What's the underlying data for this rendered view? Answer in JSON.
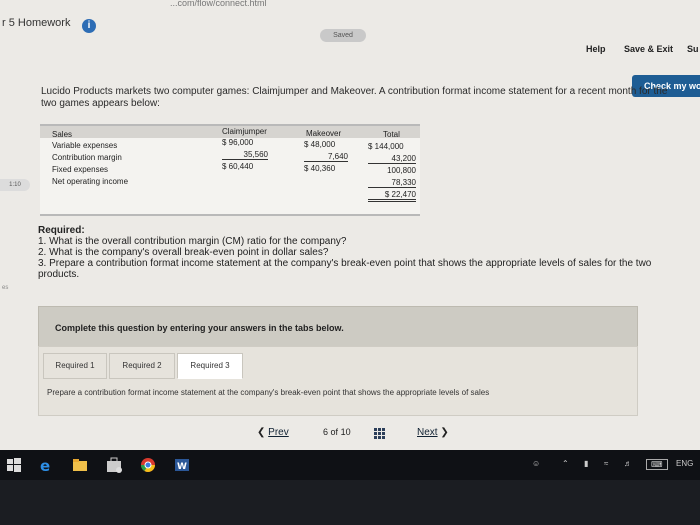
{
  "browser": {
    "url_fragment": "...com/flow/connect.html"
  },
  "header": {
    "assignment_title": "r 5 Homework",
    "info_icon": "info-icon",
    "saved_label": "Saved",
    "help_label": "Help",
    "save_exit_label": "Save & Exit",
    "submit_label": "Su",
    "check_label": "Check my wo"
  },
  "problem": {
    "intro": "Lucido Products markets two computer games: Claimjumper and Makeover. A contribution format income statement for a recent month for the two games appears below:"
  },
  "left_margin": {
    "tag": "1:10",
    "tag2": "es"
  },
  "income_table": {
    "columns": [
      "Claimjumper",
      "Makeover",
      "Total"
    ],
    "rows": [
      {
        "label": "Sales",
        "claimjumper": "$ 96,000",
        "makeover": "$ 48,000",
        "total": "$ 144,000"
      },
      {
        "label": "Variable expenses",
        "claimjumper": "35,560",
        "makeover": "7,640",
        "total": "43,200"
      },
      {
        "label": "Contribution margin",
        "claimjumper": "$ 60,440",
        "makeover": "$ 40,360",
        "total": "100,800"
      },
      {
        "label": "Fixed expenses",
        "claimjumper": "",
        "makeover": "",
        "total": "78,330"
      },
      {
        "label": "Net operating income",
        "claimjumper": "",
        "makeover": "",
        "total": "$ 22,470"
      }
    ]
  },
  "required": {
    "heading": "Required:",
    "items": [
      "1. What is the overall contribution margin (CM) ratio for the company?",
      "2. What is the company's overall break-even point in dollar sales?",
      "3. Prepare a contribution format income statement at the company's break-even point that shows the appropriate levels of sales for the two products."
    ]
  },
  "instructions": {
    "complete_text": "Complete this question by entering your answers in the tabs below."
  },
  "tabs": {
    "items": [
      {
        "label": "Required 1"
      },
      {
        "label": "Required 2"
      },
      {
        "label": "Required 3"
      }
    ],
    "active_index": 2,
    "description": "Prepare a contribution format income statement at the company's break-even point that shows the appropriate levels of sales"
  },
  "pagination": {
    "prev_label": "Prev",
    "current": "6",
    "of_label": "of",
    "total": "10",
    "next_label": "Next"
  },
  "taskbar": {
    "icons": [
      "windows-start-icon",
      "edge-icon",
      "file-explorer-icon",
      "store-icon",
      "chrome-icon",
      "word-icon"
    ],
    "tray_language": "ENG"
  },
  "colors": {
    "accent_blue": "#1e5d94",
    "page_bg": "#eceae6",
    "panel_bg": "#cdcbc3"
  }
}
